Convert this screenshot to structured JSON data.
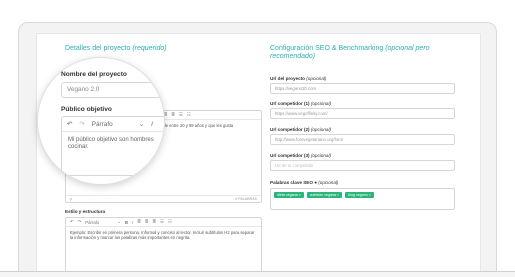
{
  "left": {
    "section_title": "Detalles del proyecto",
    "section_title_note": "(requerido)",
    "audience_text_partial": "España de entre 20 y 59 años y que les gusta",
    "word_count": "0 PALABRAS",
    "style_label": "Estilo y estructura",
    "style_toolbar": {
      "undo": "↶",
      "redo": "↷",
      "format": "Párrafo",
      "bold": "B",
      "italic": "I",
      "list": "☰",
      "numlist": "☷"
    },
    "style_text": "Ejemplo: Escribir en primera persona. Informal y conciso al lector. Incluir subtítulos H2 para separar la información y marcar las palabras más importantes en negrita."
  },
  "right": {
    "section_title": "Configuración SEO & Benchmarking",
    "section_title_note": "(opcional pero recomendado)",
    "url_project_label": "Url del proyecto",
    "url_project_note": "(opcional)",
    "url_project_value": "https://vegano20.com",
    "comp1_label": "Url competidor (1)",
    "comp1_note": "(opcional)",
    "comp1_value": "https://www.vegoffinity.com/",
    "comp2_label": "Url competidor (2)",
    "comp2_note": "(opcional)",
    "comp2_value": "http://www.forovegetariano.org/foro/",
    "comp3_label": "Url competidor (3)",
    "comp3_note": "(opcional)",
    "comp3_placeholder": "Url de tu competidor",
    "keywords_label": "Palabras clave SEO",
    "keywords_note": "(opcional)",
    "keywords": [
      "dieta vegana ×",
      "nutrición vegana ×",
      "blog vegano ×"
    ]
  },
  "magnifier": {
    "name_label": "Nombre del proyecto",
    "name_value": "Vegano 2.0",
    "audience_label": "Público objetivo",
    "format": "Párrafo",
    "undo": "↶",
    "redo": "↷",
    "italic": "I",
    "audience_text": "Mi público objetivo son hombres cocinar."
  },
  "colors": {
    "accent": "#2bb0b0",
    "tag": "#2bb57a"
  }
}
